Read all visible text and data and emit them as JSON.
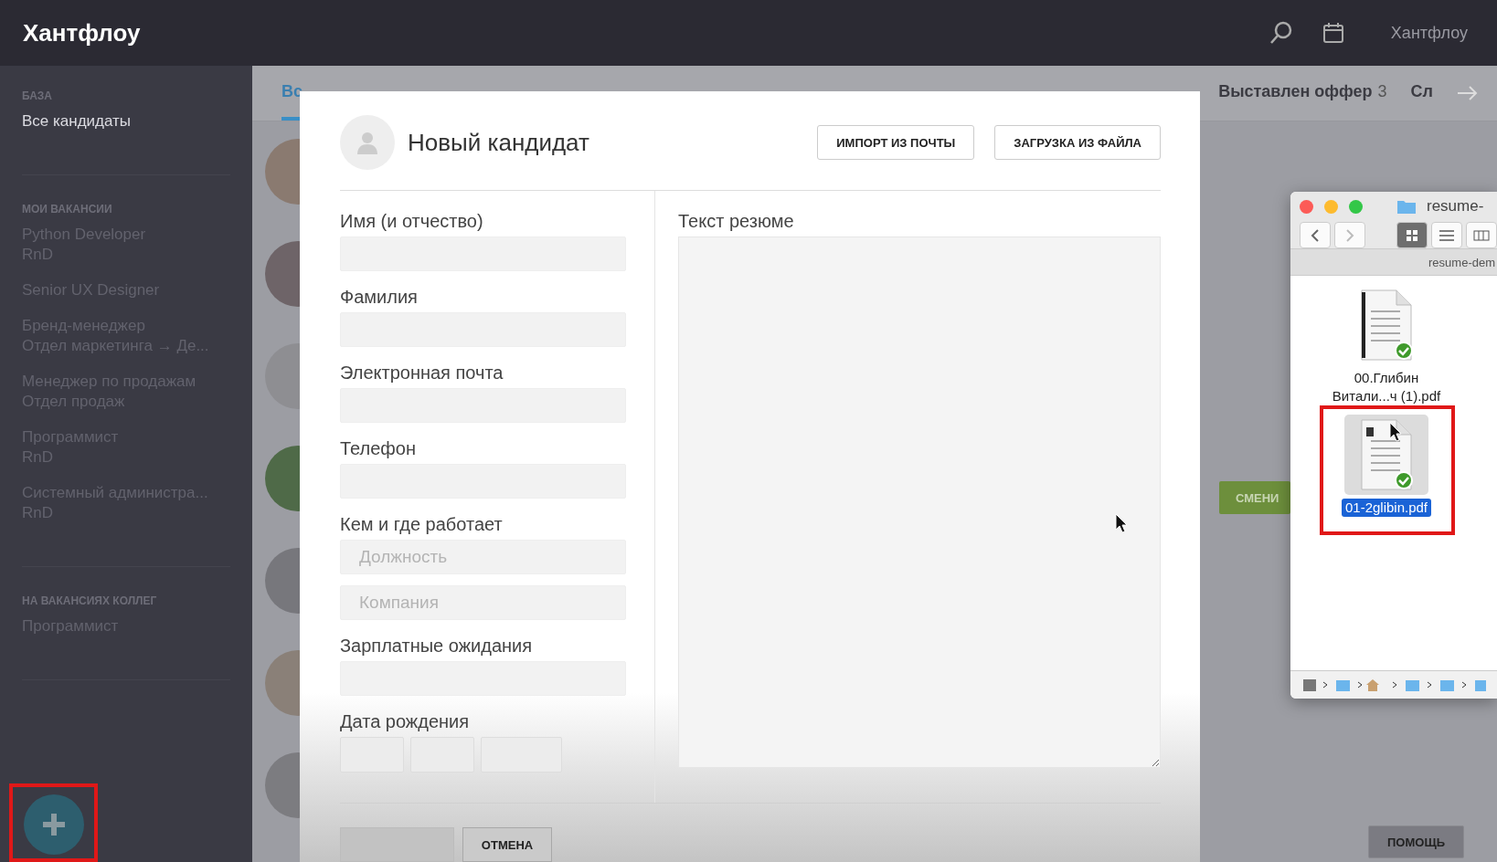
{
  "app": {
    "logo": "Хантфлоу",
    "user": "Хантфлоу"
  },
  "sidebar": {
    "sections": [
      {
        "title": "БАЗА",
        "items": [
          {
            "lines": [
              "Все кандидаты"
            ],
            "selected": true
          }
        ]
      },
      {
        "title": "МОИ ВАКАНСИИ",
        "items": [
          {
            "lines": [
              "Python Developer",
              "RnD"
            ],
            "selected": false
          },
          {
            "lines": [
              "Senior UX Designer"
            ],
            "selected": false
          },
          {
            "lines": [
              "Бренд-менеджер",
              "Отдел маркетинга → Де..."
            ],
            "selected": false
          },
          {
            "lines": [
              "Менеджер по продажам",
              "Отдел продаж"
            ],
            "selected": false
          },
          {
            "lines": [
              "Программист",
              "RnD"
            ],
            "selected": false
          },
          {
            "lines": [
              "Системный администра...",
              "RnD"
            ],
            "selected": false
          }
        ]
      },
      {
        "title": "НА ВАКАНСИЯХ КОЛЛЕГ",
        "items": [
          {
            "lines": [
              "Программист"
            ],
            "selected": false
          }
        ]
      }
    ],
    "add_button": {
      "highlighted": true
    }
  },
  "tabs": [
    {
      "label": "Вс",
      "selected": true
    },
    {
      "label": "Выставлен оффер",
      "count": "3",
      "selected": false
    },
    {
      "label": "Сл",
      "selected": false
    }
  ],
  "background_buttons": [
    {
      "label": "СМЕНИ",
      "kind": "primary"
    },
    {
      "label": "ПОМОЩЬ",
      "kind": "plain"
    }
  ],
  "modal": {
    "title": "Новый кандидат",
    "header_buttons": [
      "ИМПОРТ ИЗ ПОЧТЫ",
      "ЗАГРУЗКА ИЗ ФАЙЛА"
    ],
    "fields": [
      {
        "kind": "text",
        "label": "Имя (и отчество)"
      },
      {
        "kind": "text",
        "label": "Фамилия"
      },
      {
        "kind": "text",
        "label": "Электронная почта"
      },
      {
        "kind": "text",
        "label": "Телефон"
      },
      {
        "kind": "group",
        "label": "Кем и где работает",
        "placeholders": [
          "Должность",
          "Компания"
        ]
      },
      {
        "kind": "text",
        "label": "Зарплатные ожидания"
      },
      {
        "kind": "date",
        "label": "Дата рождения"
      }
    ],
    "resume_label": "Текст резюме",
    "footer_buttons": [
      {
        "disabled": true
      },
      {
        "label": "ОТМЕНА",
        "disabled": false
      }
    ]
  },
  "finder": {
    "title": "resume-",
    "path": "resume-dem",
    "files": [
      {
        "lines": [
          "00.Глибин",
          "Витали...ч (1).pdf"
        ],
        "selected": false,
        "highlighted": false
      },
      {
        "lines": [
          "01-2glibin.pdf"
        ],
        "selected": true,
        "highlighted": true
      }
    ]
  }
}
